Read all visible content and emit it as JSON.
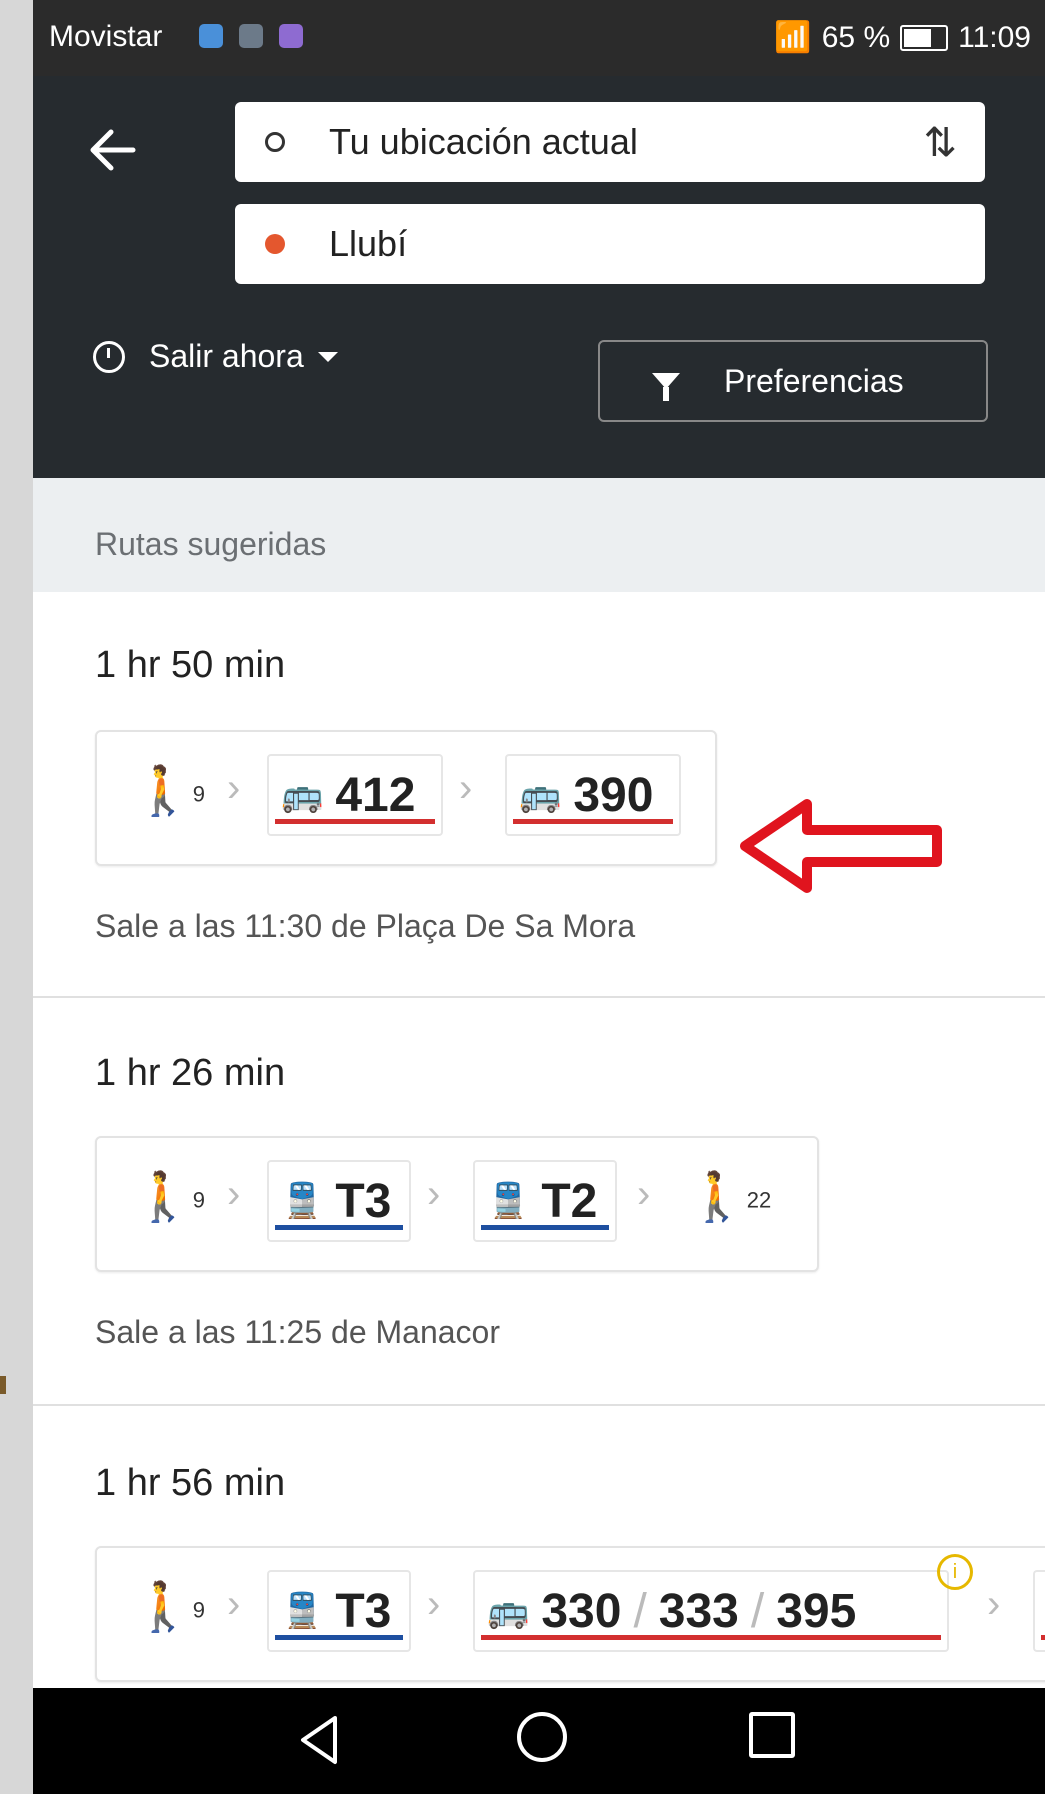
{
  "status_bar": {
    "carrier": "Movistar",
    "battery": "65 %",
    "time": "11:09"
  },
  "search": {
    "origin": "Tu ubicación actual",
    "destination": "Llubí"
  },
  "options": {
    "depart": "Salir ahora",
    "preferences": "Preferencias"
  },
  "section_title": "Rutas sugeridas",
  "routes": [
    {
      "duration": "1 hr 50 min",
      "walk_start": "9",
      "line1": "412",
      "line2": "390",
      "departure": "Sale a las 11:30 de Plaça De Sa Mora"
    },
    {
      "duration": "1 hr 26 min",
      "walk_start": "9",
      "line1": "T3",
      "line2": "T2",
      "walk_end": "22",
      "departure": "Sale a las 11:25 de Manacor"
    },
    {
      "duration": "1 hr 56 min",
      "walk_start": "9",
      "line1": "T3",
      "line2": "330",
      "sep1": "/",
      "line3": "333",
      "sep2": "/",
      "line4": "395"
    }
  ],
  "colors": {
    "bus": "#d32f2f",
    "train": "#1e4fa0",
    "header": "#262b2f",
    "arrow": "#e0141e"
  }
}
